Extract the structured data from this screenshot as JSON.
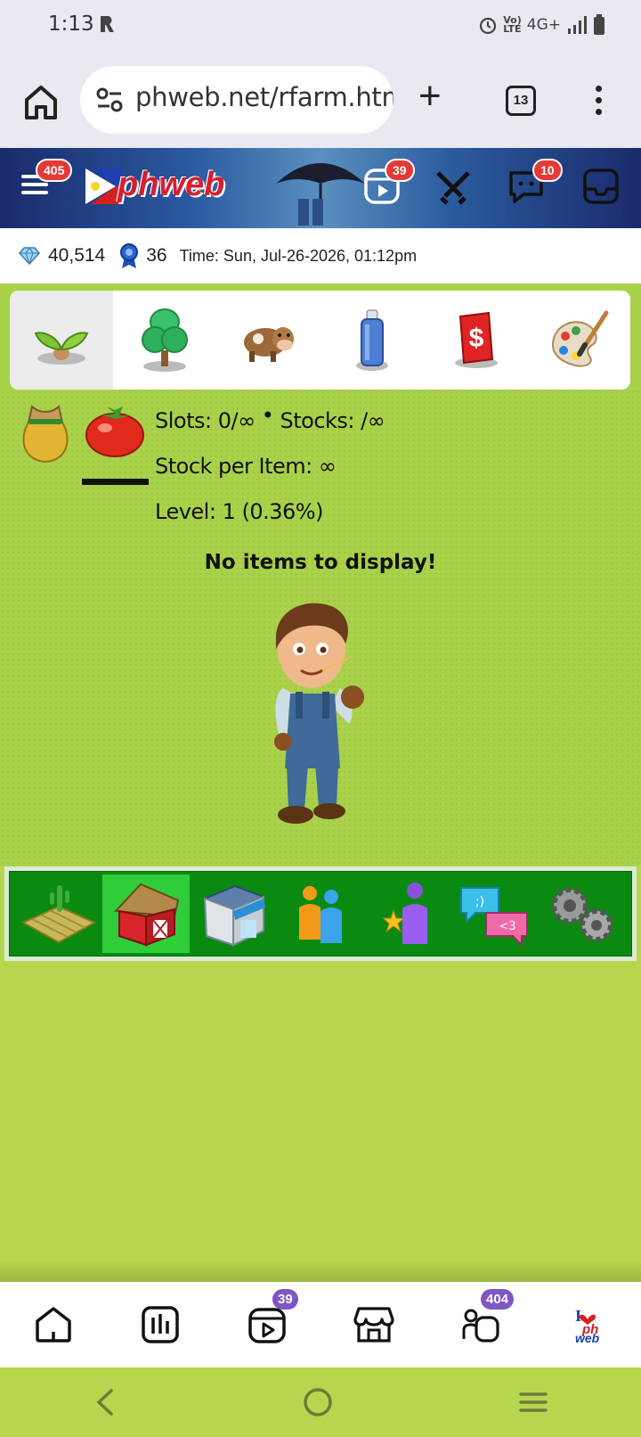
{
  "status_bar": {
    "time": "1:13",
    "network": "4G+"
  },
  "browser": {
    "url": "phweb.net/rfarm.htm",
    "tab_count": "13"
  },
  "site_header": {
    "logo": "phweb",
    "menu_badge": "405",
    "reels_badge": "39",
    "messages_badge": "10"
  },
  "stats": {
    "diamonds": "40,514",
    "ribbons": "36",
    "time": "Time: Sun, Jul-26-2026, 01:12pm"
  },
  "categories": [
    {
      "name": "seedling-icon",
      "active": true
    },
    {
      "name": "tree-icon",
      "active": false
    },
    {
      "name": "cow-icon",
      "active": false
    },
    {
      "name": "spray-can-icon",
      "active": false
    },
    {
      "name": "cash-icon",
      "active": false
    },
    {
      "name": "paint-palette-icon",
      "active": false
    }
  ],
  "storage": {
    "slots": "Slots: 0/∞",
    "separator": "•",
    "stocks": "Stocks: /∞",
    "stock_per_item": "Stock per Item: ∞",
    "level": "Level: 1 (0.36%)",
    "empty_message": "No items to display!"
  },
  "game_nav": [
    {
      "name": "farm-field-icon",
      "active": false
    },
    {
      "name": "barn-icon",
      "active": true
    },
    {
      "name": "shop-icon",
      "active": false
    },
    {
      "name": "neighbors-icon",
      "active": false
    },
    {
      "name": "ranking-icon",
      "active": false
    },
    {
      "name": "chat-icon",
      "active": false
    },
    {
      "name": "settings-gears-icon",
      "active": false
    }
  ],
  "bottom_tabs": {
    "reels_badge": "39",
    "friends_badge": "404"
  },
  "colors": {
    "grass": "#a9d24a",
    "nav_green": "#0b8a12",
    "nav_active": "#2fcd3a",
    "badge_red": "#e53935",
    "badge_purple": "#7e57c2"
  }
}
